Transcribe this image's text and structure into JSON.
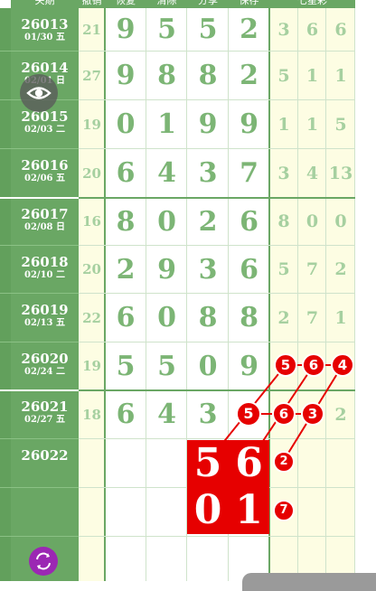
{
  "header": {
    "columns": [
      "关期",
      "撤销",
      "恢复",
      "清除",
      "分享",
      "保存",
      "七星彩"
    ]
  },
  "rows": [
    {
      "issue": "26013",
      "date": "01/30 五",
      "b": "21",
      "digits": [
        "9",
        "5",
        "5",
        "2"
      ],
      "sums": [
        "3",
        "6",
        "6"
      ]
    },
    {
      "issue": "26014",
      "date": "02/01 日",
      "b": "27",
      "digits": [
        "9",
        "8",
        "8",
        "2"
      ],
      "sums": [
        "5",
        "1",
        "1"
      ]
    },
    {
      "issue": "26015",
      "date": "02/03 二",
      "b": "19",
      "digits": [
        "0",
        "1",
        "9",
        "9"
      ],
      "sums": [
        "1",
        "1",
        "5"
      ]
    },
    {
      "issue": "26016",
      "date": "02/06 五",
      "b": "20",
      "digits": [
        "6",
        "4",
        "3",
        "7"
      ],
      "sums": [
        "3",
        "4",
        "13"
      ]
    },
    {
      "issue": "26017",
      "date": "02/08 日",
      "b": "16",
      "digits": [
        "8",
        "0",
        "2",
        "6"
      ],
      "sums": [
        "8",
        "0",
        "0"
      ]
    },
    {
      "issue": "26018",
      "date": "02/10 二",
      "b": "20",
      "digits": [
        "2",
        "9",
        "3",
        "6"
      ],
      "sums": [
        "5",
        "7",
        "2"
      ]
    },
    {
      "issue": "26019",
      "date": "02/13 五",
      "b": "22",
      "digits": [
        "6",
        "0",
        "8",
        "8"
      ],
      "sums": [
        "2",
        "7",
        "1"
      ]
    },
    {
      "issue": "26020",
      "date": "02/24 二",
      "b": "19",
      "digits": [
        "5",
        "5",
        "0",
        "9"
      ],
      "sums": [
        "",
        "",
        ""
      ]
    },
    {
      "issue": "26021",
      "date": "02/27 五",
      "b": "18",
      "digits": [
        "6",
        "4",
        "3",
        ""
      ],
      "sums": [
        "",
        "",
        "2"
      ]
    },
    {
      "issue": "26022",
      "date": "",
      "b": "",
      "digits": [
        "",
        "",
        "",
        ""
      ],
      "sums": [
        "",
        "",
        ""
      ]
    },
    {
      "issue": "",
      "date": "",
      "b": "",
      "digits": [
        "",
        "",
        "",
        ""
      ],
      "sums": [
        "",
        "",
        ""
      ]
    },
    {
      "issue": "",
      "date": "",
      "b": "",
      "digits": [
        "",
        "",
        "",
        ""
      ],
      "sums": [
        "",
        "",
        ""
      ]
    }
  ],
  "highlights": {
    "box_56": [
      "5",
      "6"
    ],
    "box_01": [
      "0",
      "1"
    ]
  },
  "balls": {
    "row20": [
      "5",
      "6",
      "4"
    ],
    "row21": [
      "5",
      "6",
      "3"
    ],
    "row22": [
      "2"
    ],
    "row23": [
      "7"
    ]
  },
  "colors": {
    "header_green": "#6aa764",
    "digit_green": "#7cb575",
    "pale_yellow": "#fdfde3",
    "highlight_red": "#e60000",
    "fab_purple": "#9b27b3"
  },
  "icons": {
    "eye": "eye-icon",
    "fab": "refresh-icon"
  }
}
